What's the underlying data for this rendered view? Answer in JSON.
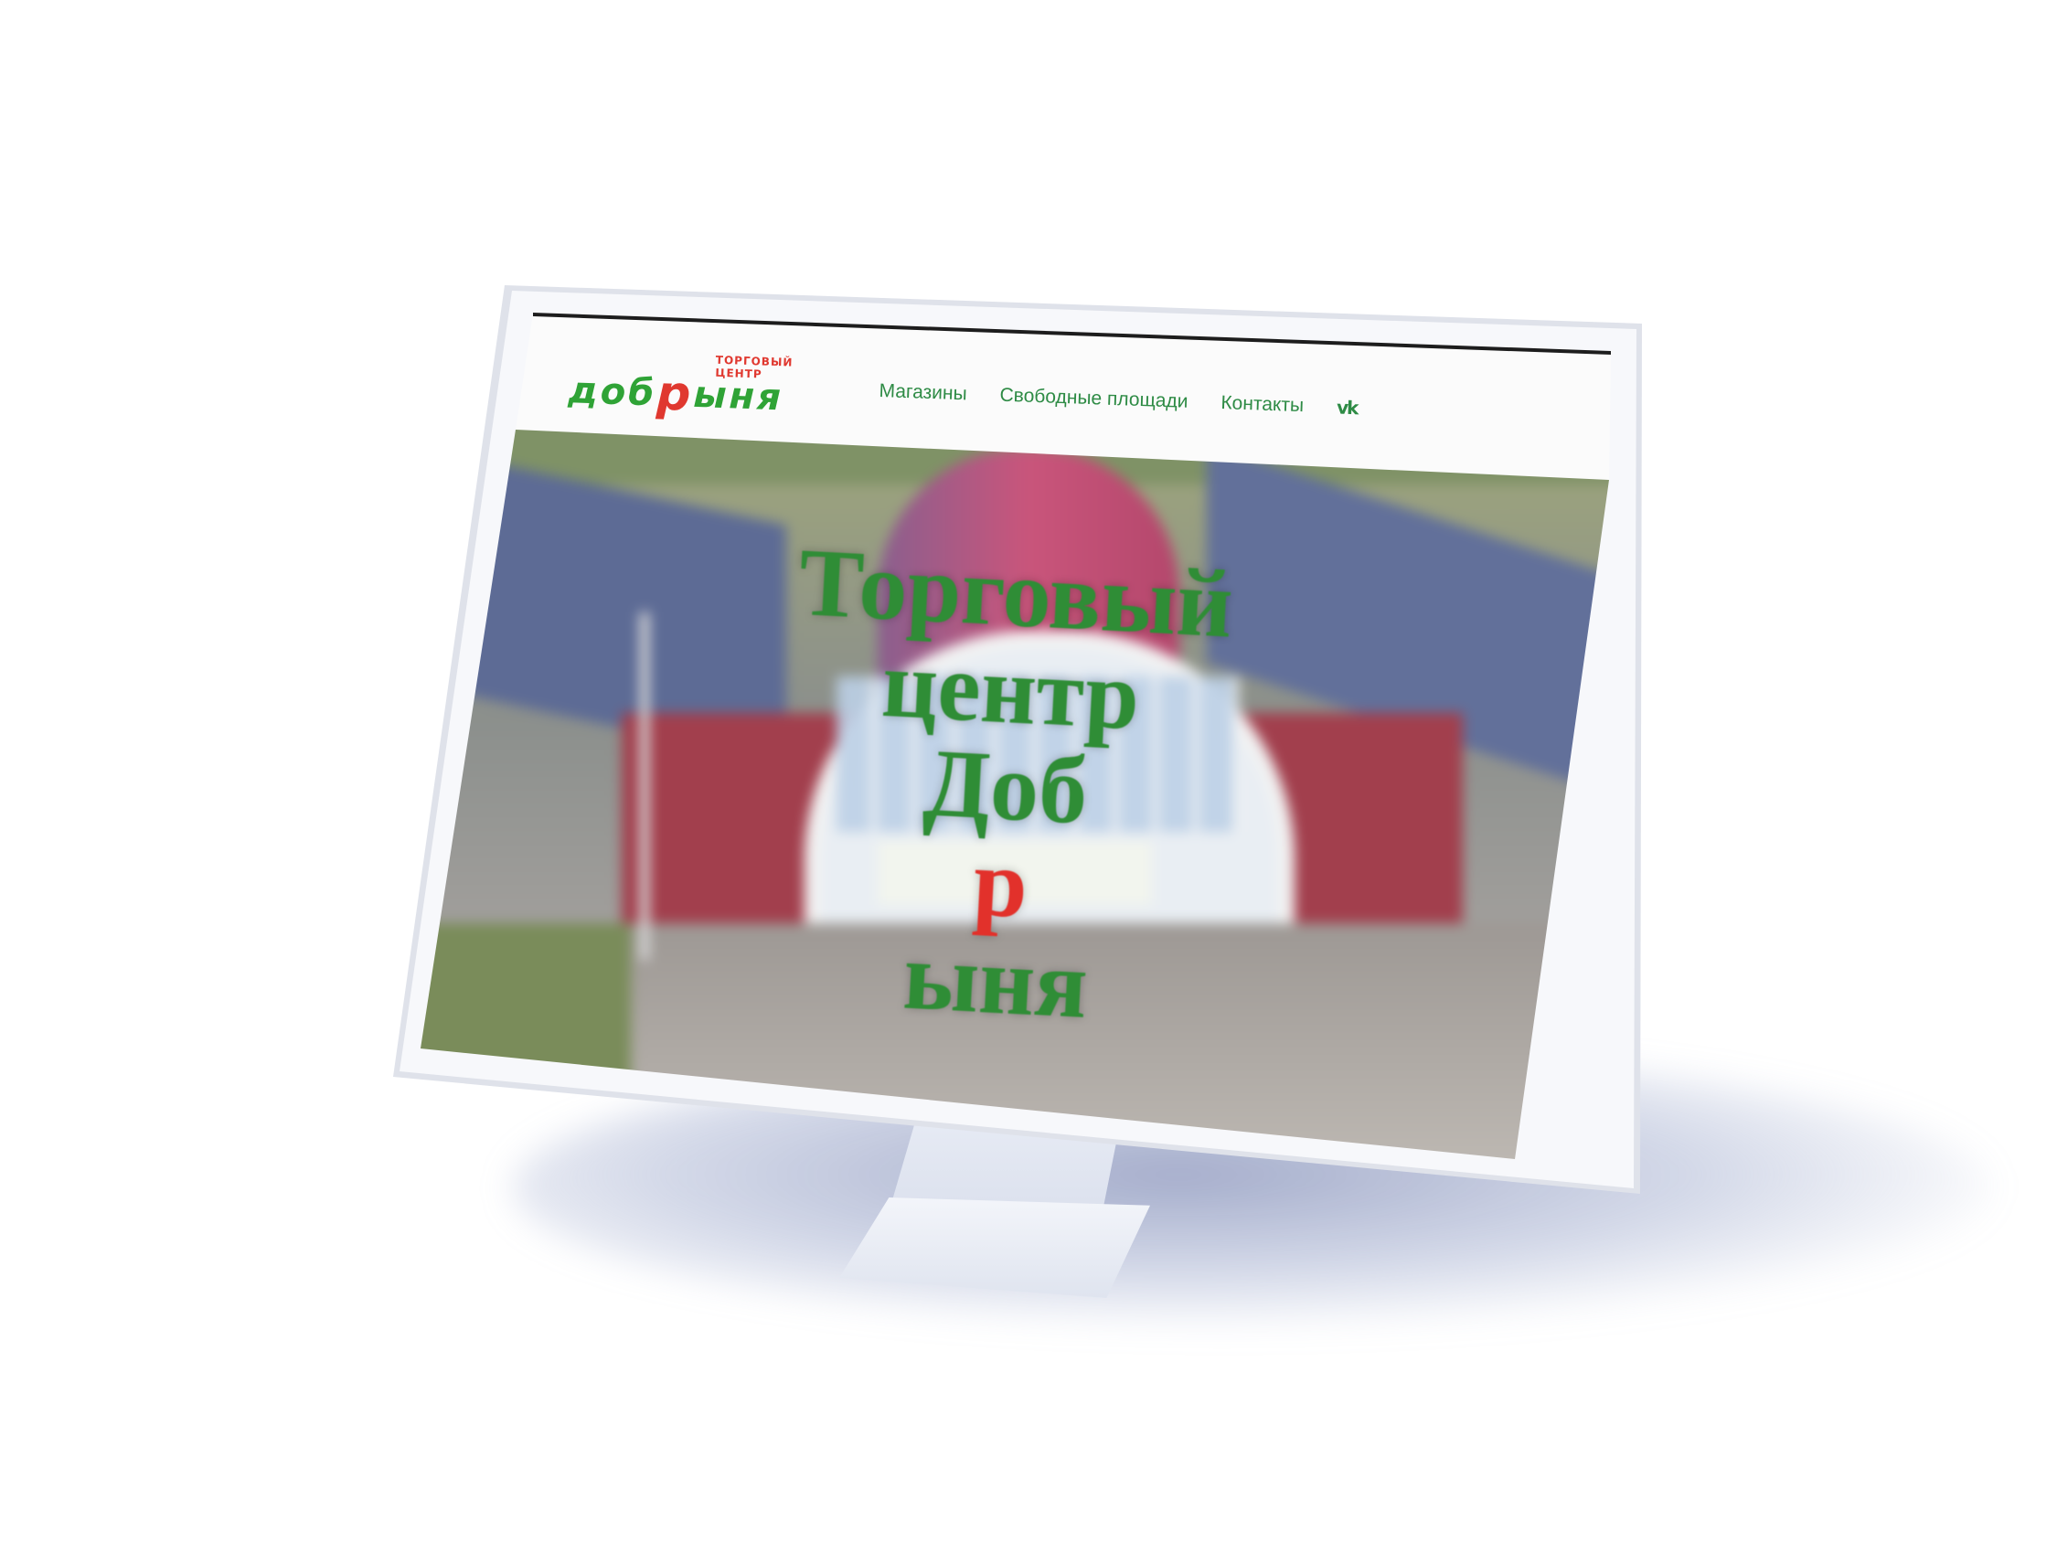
{
  "site": {
    "logo": {
      "word_part1": "доб",
      "word_accent": "р",
      "word_part2": "ыня",
      "tagline": "ТОРГОВЫЙ ЦЕНТР"
    },
    "nav": {
      "items": [
        {
          "label": "Магазины"
        },
        {
          "label": "Свободные площади"
        },
        {
          "label": "Контакты"
        }
      ],
      "social_icon": "vk-icon",
      "social_label": "vk"
    },
    "hero": {
      "line1": "Торговый",
      "line2": "центр",
      "line3_part1": "Доб",
      "line3_accent": "р",
      "line3_part2": "ыня"
    },
    "colors": {
      "brand_green": "#2e8b45",
      "accent_red": "#e2312b"
    }
  }
}
